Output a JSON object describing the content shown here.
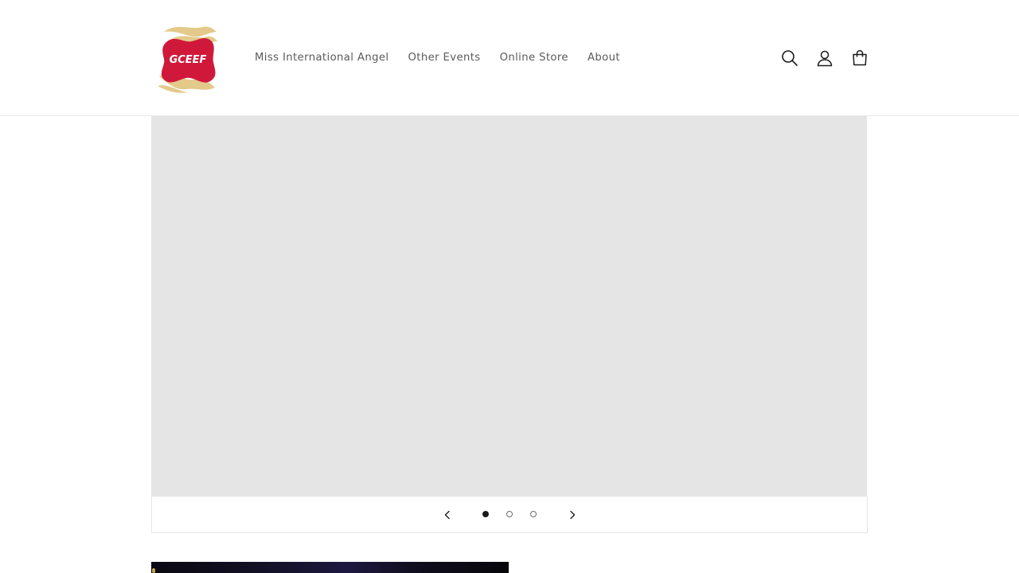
{
  "header": {
    "logo_text": "GCEEF",
    "nav": [
      {
        "label": "Miss International Angel"
      },
      {
        "label": "Other Events"
      },
      {
        "label": "Online Store"
      },
      {
        "label": "About"
      }
    ],
    "icons": [
      "search-icon",
      "account-icon",
      "cart-icon"
    ]
  },
  "slideshow": {
    "slide_count": 3,
    "active_slide": 1,
    "controls": {
      "prev_icon": "chevron-left-icon",
      "next_icon": "chevron-right-icon"
    }
  },
  "colors": {
    "nav_text": "#5a5a5a",
    "slide_placeholder": "#e5e5e5",
    "logo_red": "#d0193a",
    "logo_gold": "#e3c98a",
    "icon": "#1a1a1a"
  }
}
